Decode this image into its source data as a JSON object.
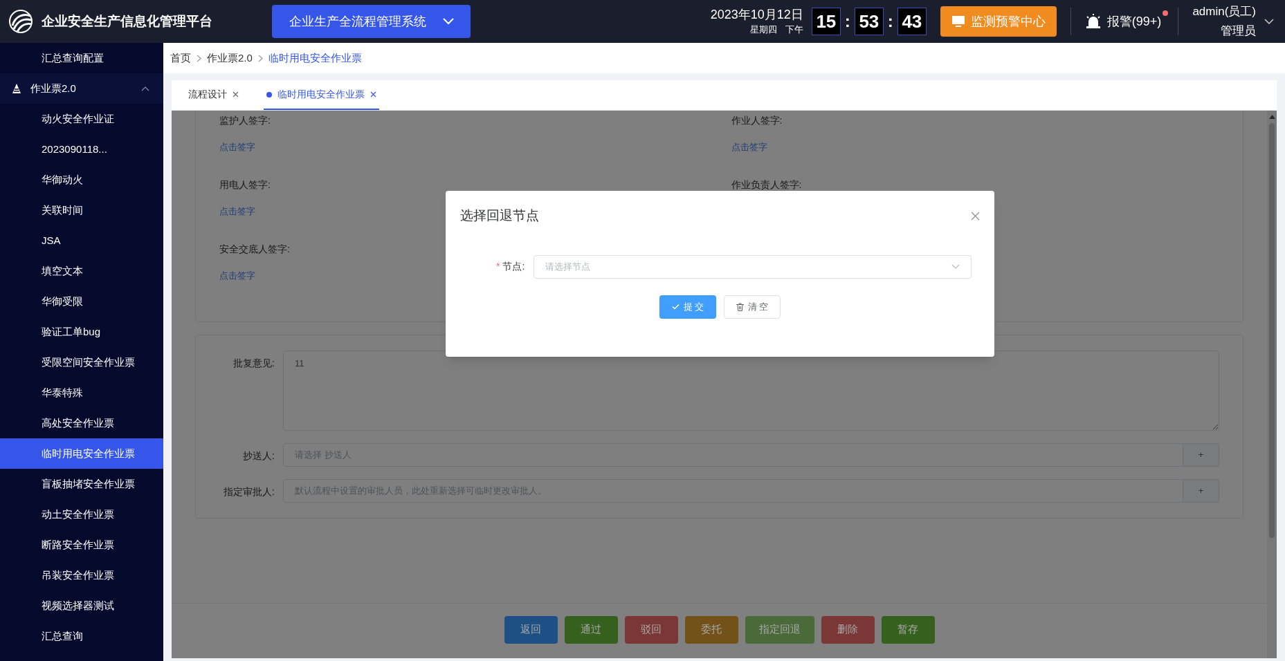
{
  "header": {
    "title": "企业安全生产信息化管理平台",
    "system_select": "企业生产全流程管理系统",
    "date": "2023年10月12日",
    "weekday": "星期四",
    "period": "下午",
    "clock": [
      "15",
      "53",
      "43"
    ],
    "clock_separator": ":",
    "monitor_button": "监测预警中心",
    "alarm": "报警(99+)",
    "alarm_dot": true,
    "user": "admin(员工)",
    "role": "管理员"
  },
  "sidebar": {
    "items": [
      {
        "label": "汇总查询配置",
        "selected": false
      },
      {
        "label": "作业票2.0",
        "expanded": true,
        "children": [
          {
            "label": "动火安全作业证",
            "selected": false
          },
          {
            "label": "2023090118...",
            "selected": false
          },
          {
            "label": "华御动火",
            "selected": false
          },
          {
            "label": "关联时间",
            "selected": false
          },
          {
            "label": "JSA",
            "selected": false
          },
          {
            "label": "填空文本",
            "selected": false
          },
          {
            "label": "华御受限",
            "selected": false
          },
          {
            "label": "验证工单bug",
            "selected": false
          },
          {
            "label": "受限空间安全作业票",
            "selected": false
          },
          {
            "label": "华泰特殊",
            "selected": false
          },
          {
            "label": "高处安全作业票",
            "selected": false
          },
          {
            "label": "临时用电安全作业票",
            "selected": true
          },
          {
            "label": "盲板抽堵安全作业票",
            "selected": false
          },
          {
            "label": "动土安全作业票",
            "selected": false
          },
          {
            "label": "断路安全作业票",
            "selected": false
          },
          {
            "label": "吊装安全作业票",
            "selected": false
          },
          {
            "label": "视频选择器测试",
            "selected": false
          },
          {
            "label": "汇总查询",
            "selected": false
          }
        ]
      }
    ]
  },
  "breadcrumb": [
    "首页",
    "作业票2.0",
    "临时用电安全作业票"
  ],
  "tabs": [
    {
      "label": "流程设计",
      "selected": false
    },
    {
      "label": "临时用电安全作业票",
      "selected": true
    }
  ],
  "signatures": {
    "left": [
      {
        "label": "监护人签字:",
        "link": "点击签字"
      },
      {
        "label": "用电人签字:",
        "link": "点击签字"
      },
      {
        "label": "安全交底人签字:",
        "link": "点击签字"
      }
    ],
    "right": [
      {
        "label": "作业人签字:",
        "link": "点击签字"
      },
      {
        "label": "作业负责人签字:"
      }
    ]
  },
  "approval": {
    "comment_label": "批复意见:",
    "comment_value": "11",
    "cc_label": "抄送人:",
    "cc_placeholder": "请选择 抄送人",
    "cc_add": "+",
    "approver_label": "指定审批人:",
    "approver_placeholder": "默认流程中设置的审批人员，此处重新选择可临时更改审批人。",
    "approver_add": "+"
  },
  "actions": [
    {
      "label": "返回",
      "color": "#1f5085"
    },
    {
      "label": "通过",
      "color": "#35601e"
    },
    {
      "label": "驳回",
      "color": "#7b3636"
    },
    {
      "label": "委托",
      "color": "#735219"
    },
    {
      "label": "指定回退",
      "color": "#4a6a3a"
    },
    {
      "label": "删除",
      "color": "#7b3636"
    },
    {
      "label": "暂存",
      "color": "#35601e"
    }
  ],
  "dialog": {
    "title": "选择回退节点",
    "required_mark": "*",
    "field_label": "节点:",
    "field_placeholder": "请选择节点",
    "submit": "提 交",
    "clear": "清 空"
  }
}
